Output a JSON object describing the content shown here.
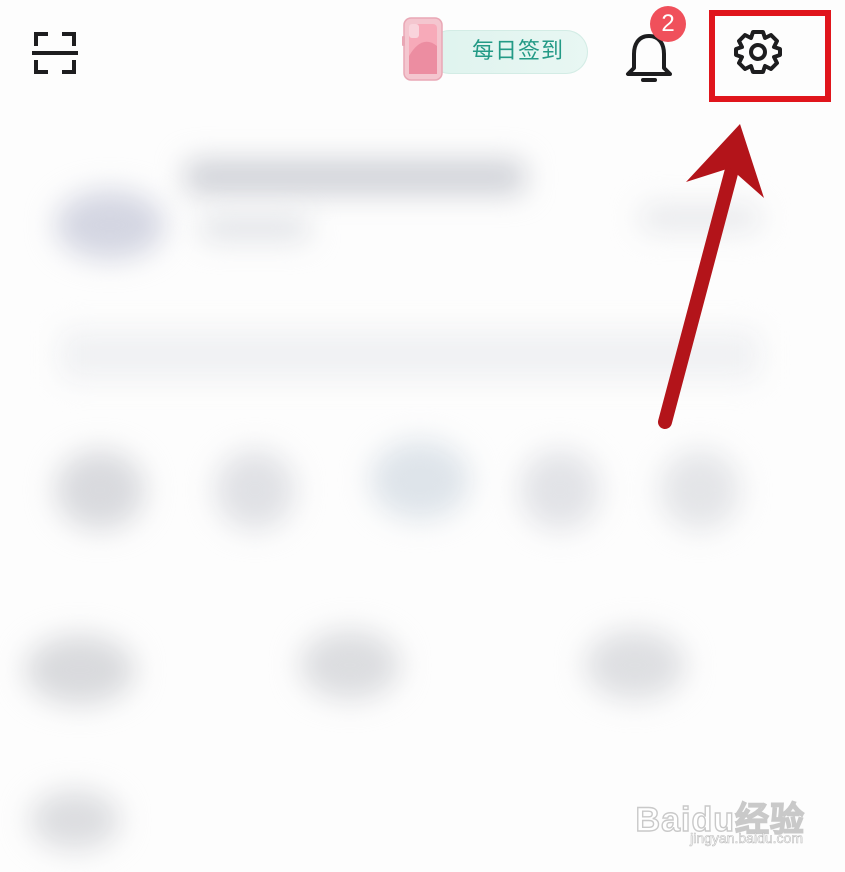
{
  "top_bar": {
    "checkin_label": "每日签到",
    "notification_count": "2"
  },
  "icons": {
    "scan": "scan-icon",
    "checkin_prize": "phone-icon",
    "notifications": "bell-icon",
    "settings": "gear-icon"
  },
  "annotation": {
    "highlight_color": "#e0151c",
    "arrow_color": "#b3141a"
  },
  "watermark": {
    "brand": "Baidu经验",
    "url": "jingyan.baidu.com"
  },
  "colors": {
    "checkin_text": "#239a86",
    "checkin_bg": "#dff3ee",
    "badge": "#f0505b"
  }
}
